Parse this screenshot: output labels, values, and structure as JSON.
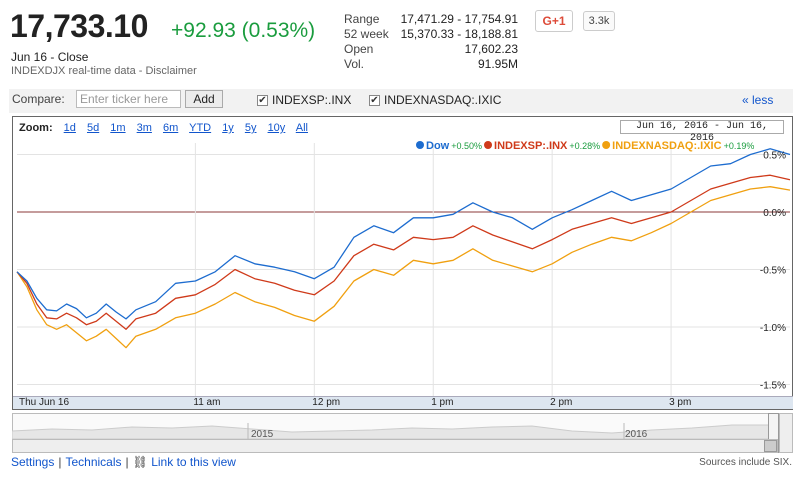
{
  "quote": {
    "price": "17,733.10",
    "change": "+92.93 (0.53%)",
    "date_close": "Jun 16 - Close",
    "disclaimer": "INDEXDJX real-time data - Disclaimer"
  },
  "stats": [
    {
      "label": "Range",
      "value": "17,471.29 - 17,754.91"
    },
    {
      "label": "52 week",
      "value": "15,370.33 - 18,188.81"
    },
    {
      "label": "Open",
      "value": "17,602.23"
    },
    {
      "label": "Vol.",
      "value": "91.95M"
    }
  ],
  "social": {
    "gplus_label": "G+1",
    "count": "3.3k"
  },
  "compare": {
    "label": "Compare:",
    "placeholder": "Enter ticker here",
    "add_label": "Add",
    "tickers": [
      {
        "label": "INDEXSP:.INX",
        "checked": true
      },
      {
        "label": "INDEXNASDAQ:.IXIC",
        "checked": true
      }
    ],
    "less_label": "« less"
  },
  "zoom": {
    "label": "Zoom:",
    "options": [
      "1d",
      "5d",
      "1m",
      "3m",
      "6m",
      "YTD",
      "1y",
      "5y",
      "10y",
      "All"
    ],
    "date_range": "Jun 16, 2016 - Jun 16, 2016"
  },
  "navigator": {
    "years": [
      "2015",
      "2016"
    ]
  },
  "footer": {
    "settings": "Settings",
    "technicals": "Technicals",
    "link": "Link to this view",
    "sources": "Sources include SIX."
  },
  "colors": {
    "dow": "#1d6ccf",
    "inx": "#cf3a1a",
    "ixic": "#f0a010"
  },
  "chart_data": {
    "type": "line",
    "ylim": [
      -1.6,
      0.6
    ],
    "yticks": [
      0.5,
      0.0,
      -0.5,
      -1.0,
      -1.5
    ],
    "ytick_labels": [
      "0.5%",
      "0.0%",
      "-0.5%",
      "-1.0%",
      "-1.5%"
    ],
    "xlim": [
      "09:30",
      "16:00"
    ],
    "xticks": [
      "09:30",
      "11:00",
      "12:00",
      "13:00",
      "14:00",
      "15:00"
    ],
    "xtick_labels": [
      "Thu Jun 16",
      "11 am",
      "12 pm",
      "1 pm",
      "2 pm",
      "3 pm"
    ],
    "grid": true,
    "legend": "top-right",
    "series": [
      {
        "name": "Dow",
        "legend_value": "+0.50%",
        "x": [
          "09:30",
          "09:35",
          "09:40",
          "09:45",
          "09:50",
          "09:55",
          "10:00",
          "10:05",
          "10:10",
          "10:15",
          "10:20",
          "10:25",
          "10:30",
          "10:40",
          "10:50",
          "11:00",
          "11:10",
          "11:20",
          "11:30",
          "11:40",
          "11:50",
          "12:00",
          "12:10",
          "12:20",
          "12:30",
          "12:40",
          "12:50",
          "13:00",
          "13:10",
          "13:20",
          "13:30",
          "13:40",
          "13:50",
          "14:00",
          "14:10",
          "14:20",
          "14:30",
          "14:40",
          "14:50",
          "15:00",
          "15:10",
          "15:20",
          "15:30",
          "15:40",
          "15:50",
          "16:00"
        ],
        "y": [
          -0.52,
          -0.6,
          -0.75,
          -0.85,
          -0.86,
          -0.8,
          -0.84,
          -0.92,
          -0.88,
          -0.8,
          -0.87,
          -0.93,
          -0.85,
          -0.78,
          -0.62,
          -0.6,
          -0.52,
          -0.38,
          -0.45,
          -0.48,
          -0.52,
          -0.58,
          -0.48,
          -0.22,
          -0.12,
          -0.18,
          -0.05,
          -0.05,
          -0.02,
          0.08,
          0.0,
          -0.05,
          -0.15,
          -0.05,
          0.02,
          0.1,
          0.18,
          0.1,
          0.15,
          0.2,
          0.3,
          0.4,
          0.42,
          0.5,
          0.55,
          0.5
        ]
      },
      {
        "name": "INDEXSP:.INX",
        "legend_value": "+0.28%",
        "x": [
          "09:30",
          "09:35",
          "09:40",
          "09:45",
          "09:50",
          "09:55",
          "10:00",
          "10:05",
          "10:10",
          "10:15",
          "10:20",
          "10:25",
          "10:30",
          "10:40",
          "10:50",
          "11:00",
          "11:10",
          "11:20",
          "11:30",
          "11:40",
          "11:50",
          "12:00",
          "12:10",
          "12:20",
          "12:30",
          "12:40",
          "12:50",
          "13:00",
          "13:10",
          "13:20",
          "13:30",
          "13:40",
          "13:50",
          "14:00",
          "14:10",
          "14:20",
          "14:30",
          "14:40",
          "14:50",
          "15:00",
          "15:10",
          "15:20",
          "15:30",
          "15:40",
          "15:50",
          "16:00"
        ],
        "y": [
          -0.52,
          -0.62,
          -0.8,
          -0.92,
          -0.93,
          -0.88,
          -0.92,
          -0.98,
          -0.95,
          -0.88,
          -0.95,
          -1.02,
          -0.93,
          -0.88,
          -0.75,
          -0.72,
          -0.63,
          -0.5,
          -0.58,
          -0.62,
          -0.68,
          -0.72,
          -0.6,
          -0.38,
          -0.28,
          -0.33,
          -0.22,
          -0.24,
          -0.22,
          -0.12,
          -0.2,
          -0.26,
          -0.32,
          -0.24,
          -0.15,
          -0.1,
          -0.05,
          -0.1,
          -0.05,
          0.0,
          0.1,
          0.2,
          0.25,
          0.3,
          0.32,
          0.28
        ]
      },
      {
        "name": "INDEXNASDAQ:.IXIC",
        "legend_value": "+0.19%",
        "x": [
          "09:30",
          "09:35",
          "09:40",
          "09:45",
          "09:50",
          "09:55",
          "10:00",
          "10:05",
          "10:10",
          "10:15",
          "10:20",
          "10:25",
          "10:30",
          "10:40",
          "10:50",
          "11:00",
          "11:10",
          "11:20",
          "11:30",
          "11:40",
          "11:50",
          "12:00",
          "12:10",
          "12:20",
          "12:30",
          "12:40",
          "12:50",
          "13:00",
          "13:10",
          "13:20",
          "13:30",
          "13:40",
          "13:50",
          "14:00",
          "14:10",
          "14:20",
          "14:30",
          "14:40",
          "14:50",
          "15:00",
          "15:10",
          "15:20",
          "15:30",
          "15:40",
          "15:50",
          "16:00"
        ],
        "y": [
          -0.52,
          -0.65,
          -0.85,
          -0.98,
          -1.02,
          -0.98,
          -1.05,
          -1.12,
          -1.08,
          -1.02,
          -1.1,
          -1.18,
          -1.08,
          -1.02,
          -0.92,
          -0.88,
          -0.8,
          -0.7,
          -0.78,
          -0.83,
          -0.9,
          -0.95,
          -0.82,
          -0.6,
          -0.5,
          -0.55,
          -0.42,
          -0.45,
          -0.42,
          -0.32,
          -0.42,
          -0.47,
          -0.52,
          -0.45,
          -0.35,
          -0.28,
          -0.22,
          -0.25,
          -0.18,
          -0.1,
          0.0,
          0.1,
          0.15,
          0.2,
          0.22,
          0.19
        ]
      }
    ]
  }
}
